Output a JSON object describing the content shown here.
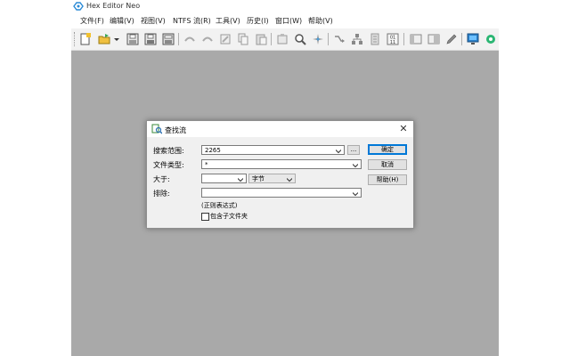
{
  "window": {
    "title": "Hex Editor Neo"
  },
  "menu": {
    "items": [
      "文件(F)",
      "编辑(V)",
      "视图(V)",
      "NTFS 流(R)",
      "工具(V)",
      "历史(I)",
      "窗口(W)",
      "帮助(V)"
    ]
  },
  "toolbar": {
    "icons": [
      "new-file-icon",
      "open-folder-icon",
      "dropdown-arrow-icon",
      "save-icon",
      "save-as-icon",
      "save-all-icon",
      "undo-icon",
      "redo-icon",
      "edit-icon",
      "copy-icon",
      "paste-icon",
      "cut-icon",
      "find-icon",
      "find-replace-icon",
      "history-icon",
      "tree-icon",
      "bookmark-icon",
      "binary-icon",
      "panel-icon",
      "panel-split-icon",
      "pen-icon",
      "monitor-icon",
      "settings-icon"
    ]
  },
  "dialog": {
    "title": "查找流",
    "close_glyph": "✕",
    "search_range_label": "搜索范围:",
    "search_range_value": "2265",
    "browse_label": "...",
    "file_type_label": "文件类型:",
    "file_type_value": "*",
    "size_gt_label": "大于:",
    "size_value": "",
    "size_unit": "字节",
    "exclude_label": "排除:",
    "exclude_value": "",
    "regex_note": "(正则表达式)",
    "include_subfolders_label": "包含子文件夹",
    "include_subfolders_checked": false,
    "ok_label": "确定",
    "cancel_label": "取消",
    "help_label": "帮助(H)"
  },
  "colors": {
    "workspace": "#a9a9a9",
    "accent": "#0078d7",
    "logo": "#2a8ad6"
  }
}
